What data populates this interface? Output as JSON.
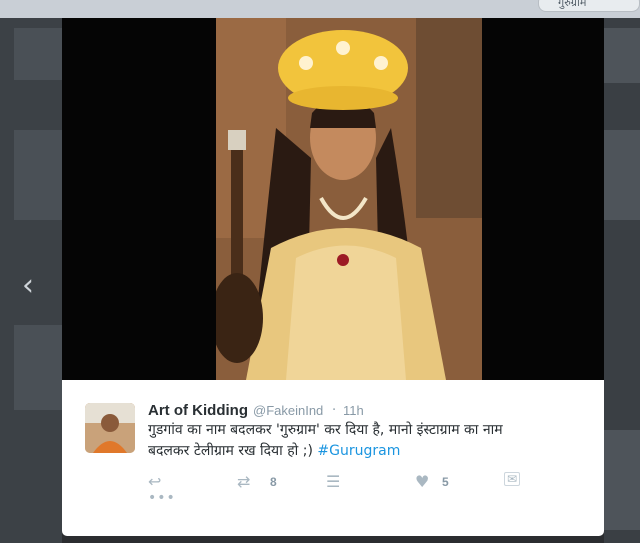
{
  "search": {
    "value": "गुरुग्राम"
  },
  "nav": {
    "prev_icon": "chevron-left-icon"
  },
  "tweet": {
    "author_name": "Art of Kidding",
    "handle": "@FakeinInd",
    "separator": "·",
    "time": "11h",
    "text_line1": "गुडगांव का नाम बदलकर 'गुरुग्राम' कर दिया है, मानो इंस्टाग्राम का नाम",
    "text_line2": "बदलकर टेलीग्राम रख दिया हो ;)",
    "hashtag": "#Gurugram",
    "retweet_count": "8",
    "like_count": "5"
  },
  "colors": {
    "link": "#1b95e0",
    "muted": "#8899a6",
    "text": "#292f33"
  }
}
